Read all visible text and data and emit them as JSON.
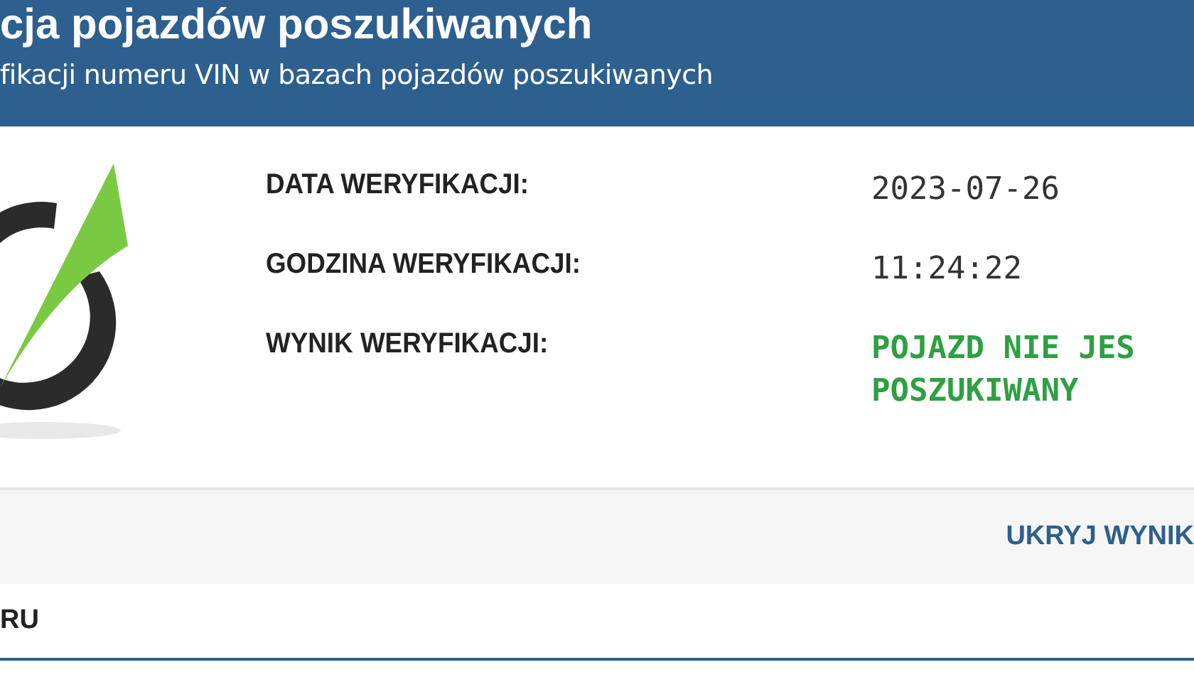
{
  "header": {
    "title": "cja pojazdów poszukiwanych",
    "subtitle": "fikacji numeru VIN w bazach pojazdów poszukiwanych"
  },
  "result": {
    "fields": [
      {
        "label": "DATA WERYFIKACJI:",
        "value_lines": [
          "2023-07-26"
        ],
        "kind": "plain"
      },
      {
        "label": "GODZINA WERYFIKACJI:",
        "value_lines": [
          "11:24:22"
        ],
        "kind": "plain"
      },
      {
        "label": "WYNIK WERYFIKACJI:",
        "value_lines": [
          "POJAZD NIE JES",
          "POSZUKIWANY"
        ],
        "kind": "positive"
      }
    ]
  },
  "toolbar": {
    "link": "UKRYJ WYNIK"
  },
  "section": {
    "heading": "RU"
  }
}
